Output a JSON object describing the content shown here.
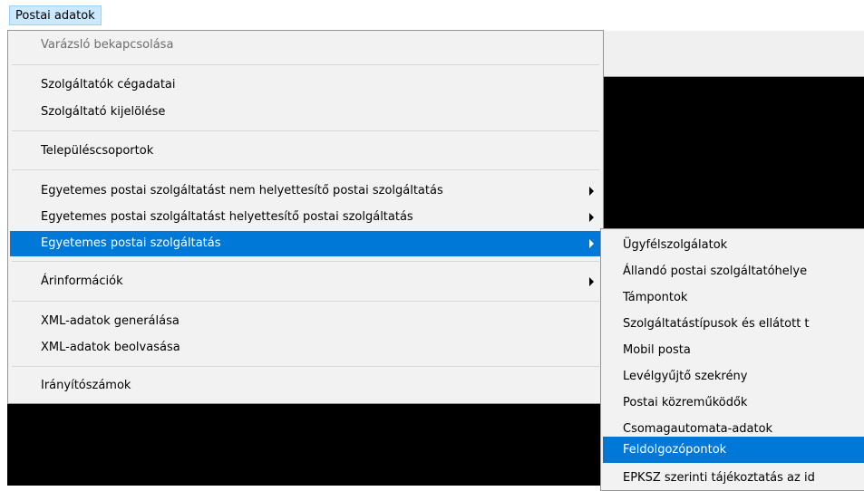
{
  "menubar": {
    "menu_label": "Postai adatok"
  },
  "dropdown": {
    "items": [
      {
        "label": "Varázsló bekapcsolása"
      },
      {
        "label": "Szolgáltatók cégadatai"
      },
      {
        "label": "Szolgáltató kijelölése"
      },
      {
        "label": "Településcsoportok"
      },
      {
        "label": "Egyetemes postai szolgáltatást nem helyettesítő postai szolgáltatás"
      },
      {
        "label": "Egyetemes postai szolgáltatást helyettesítő postai szolgáltatás"
      },
      {
        "label": "Egyetemes postai szolgáltatás"
      },
      {
        "label": "Árinformációk"
      },
      {
        "label": "XML-adatok generálása"
      },
      {
        "label": "XML-adatok beolvasása"
      },
      {
        "label": "Irányítószámok"
      }
    ]
  },
  "submenu": {
    "items": [
      {
        "label": "Ügyfélszolgálatok"
      },
      {
        "label": "Állandó postai szolgáltatóhelye"
      },
      {
        "label": "Támpontok"
      },
      {
        "label": "Szolgáltatástípusok és ellátott t"
      },
      {
        "label": "Mobil posta"
      },
      {
        "label": "Levélgyűjtő szekrény"
      },
      {
        "label": "Postai közreműködők"
      },
      {
        "label": "Csomagautomata-adatok"
      },
      {
        "label": "Feldolgozópontok"
      },
      {
        "label": "EPKSZ szerinti tájékoztatás az id"
      }
    ]
  },
  "colors": {
    "highlight": "#0078d7",
    "menu_bg": "#f2f2f2",
    "background_window": "#000000"
  }
}
